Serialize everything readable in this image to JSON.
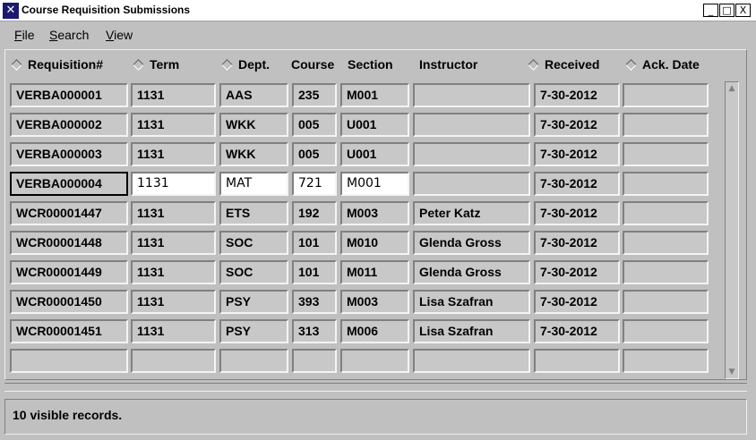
{
  "window": {
    "title": "Course Requisition Submissions",
    "icon": "x-icon",
    "controls": {
      "minimize": "_",
      "maximize": "□",
      "close": "X"
    }
  },
  "menu": {
    "file": "File",
    "search": "Search",
    "view": "View"
  },
  "columns": {
    "requisition": "Requisition#",
    "term": "Term",
    "dept": "Dept.",
    "course": "Course",
    "section": "Section",
    "instructor": "Instructor",
    "received": "Received",
    "ack_date": "Ack. Date"
  },
  "rows": [
    {
      "requisition": "VERBA000001",
      "term": "1131",
      "dept": "AAS",
      "course": "235",
      "section": "M001",
      "instructor": "",
      "received": "7-30-2012",
      "ack_date": ""
    },
    {
      "requisition": "VERBA000002",
      "term": "1131",
      "dept": "WKK",
      "course": "005",
      "section": "U001",
      "instructor": "",
      "received": "7-30-2012",
      "ack_date": ""
    },
    {
      "requisition": "VERBA000003",
      "term": "1131",
      "dept": "WKK",
      "course": "005",
      "section": "U001",
      "instructor": "",
      "received": "7-30-2012",
      "ack_date": ""
    },
    {
      "requisition": "VERBA000004",
      "term": "1131",
      "dept": "MAT",
      "course": "721",
      "section": "M001",
      "instructor": "",
      "received": "7-30-2012",
      "ack_date": ""
    },
    {
      "requisition": "WCR00001447",
      "term": "1131",
      "dept": "ETS",
      "course": "192",
      "section": "M003",
      "instructor": "Peter Katz",
      "received": "7-30-2012",
      "ack_date": ""
    },
    {
      "requisition": "WCR00001448",
      "term": "1131",
      "dept": "SOC",
      "course": "101",
      "section": "M010",
      "instructor": "Glenda Gross",
      "received": "7-30-2012",
      "ack_date": ""
    },
    {
      "requisition": "WCR00001449",
      "term": "1131",
      "dept": "SOC",
      "course": "101",
      "section": "M011",
      "instructor": "Glenda Gross",
      "received": "7-30-2012",
      "ack_date": ""
    },
    {
      "requisition": "WCR00001450",
      "term": "1131",
      "dept": "PSY",
      "course": "393",
      "section": "M003",
      "instructor": "Lisa Szafran",
      "received": "7-30-2012",
      "ack_date": ""
    },
    {
      "requisition": "WCR00001451",
      "term": "1131",
      "dept": "PSY",
      "course": "313",
      "section": "M006",
      "instructor": "Lisa Szafran",
      "received": "7-30-2012",
      "ack_date": ""
    },
    {
      "requisition": "",
      "term": "",
      "dept": "",
      "course": "",
      "section": "",
      "instructor": "",
      "received": "",
      "ack_date": ""
    }
  ],
  "status": "10 visible records."
}
